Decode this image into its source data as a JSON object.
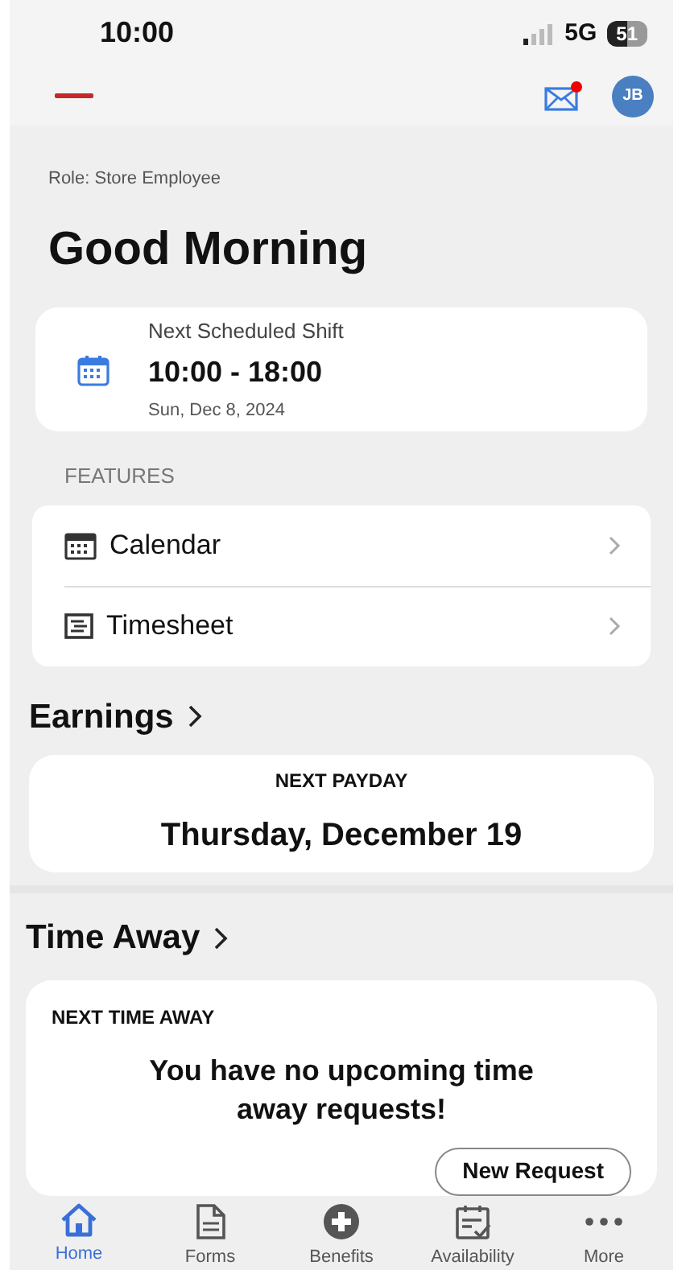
{
  "status_bar": {
    "time": "10:00",
    "network": "5G",
    "battery": "51"
  },
  "header": {
    "avatar": "JB",
    "mail_unread": true
  },
  "role": "Role: Store Employee",
  "greeting": "Good Morning",
  "shift": {
    "label": "Next Scheduled Shift",
    "time": "10:00 - 18:00",
    "date": "Sun, Dec 8, 2024"
  },
  "features": {
    "heading": "FEATURES",
    "items": [
      {
        "label": "Calendar"
      },
      {
        "label": "Timesheet"
      }
    ]
  },
  "earnings": {
    "title": "Earnings",
    "caption": "NEXT PAYDAY",
    "value": "Thursday, December 19"
  },
  "time_away": {
    "title": "Time Away",
    "caption": "NEXT TIME AWAY",
    "message": "You have no upcoming time away requests!",
    "button": "New Request"
  },
  "tabs": [
    {
      "label": "Home",
      "selected": true
    },
    {
      "label": "Forms",
      "selected": false
    },
    {
      "label": "Benefits",
      "selected": false
    },
    {
      "label": "Availability",
      "selected": false
    },
    {
      "label": "More",
      "selected": false
    }
  ]
}
